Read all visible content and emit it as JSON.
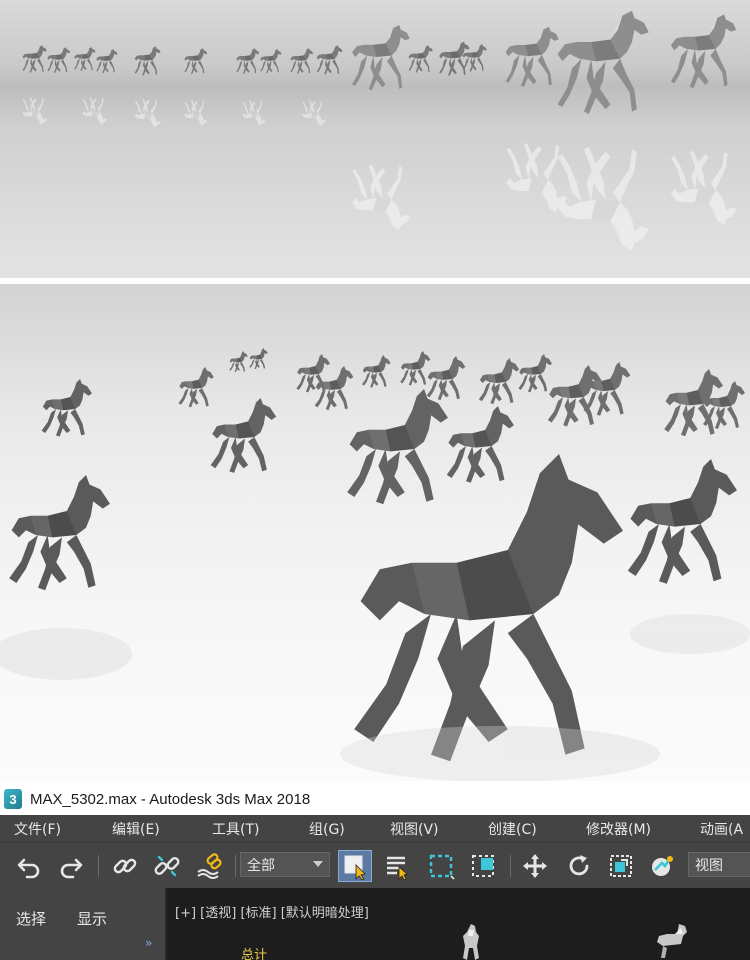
{
  "window": {
    "app_icon_text": "3",
    "title": "MAX_5302.max - Autodesk 3ds Max 2018"
  },
  "menubar": {
    "items": [
      "文件(F)",
      "编辑(E)",
      "工具(T)",
      "组(G)",
      "视图(V)",
      "创建(C)",
      "修改器(M)",
      "动画(A"
    ]
  },
  "toolbar": {
    "selection_filter": "全部",
    "view_dropdown": "视图",
    "icons": [
      "undo-icon",
      "redo-icon",
      "link-icon",
      "unlink-icon",
      "bind-space-warp-icon",
      "select-object-icon",
      "select-by-name-icon",
      "rectangular-selection-region-icon",
      "window-crossing-icon",
      "select-move-icon",
      "select-rotate-icon",
      "select-scale-icon",
      "selection-center-icon"
    ]
  },
  "command_panel": {
    "tabs": [
      "选择",
      "显示"
    ],
    "more": "»"
  },
  "viewport": {
    "label": "[+] [透视] [标准] [默认明暗处理]",
    "stats_label": "总计"
  },
  "colors": {
    "menubar_bg": "#444444",
    "viewport_bg": "#1d1d1d",
    "active_tool": "#5d7aa3",
    "stats_text": "#e8c84a",
    "icon_cyan": "#3cc6d8",
    "icon_yellow": "#f2b818"
  }
}
